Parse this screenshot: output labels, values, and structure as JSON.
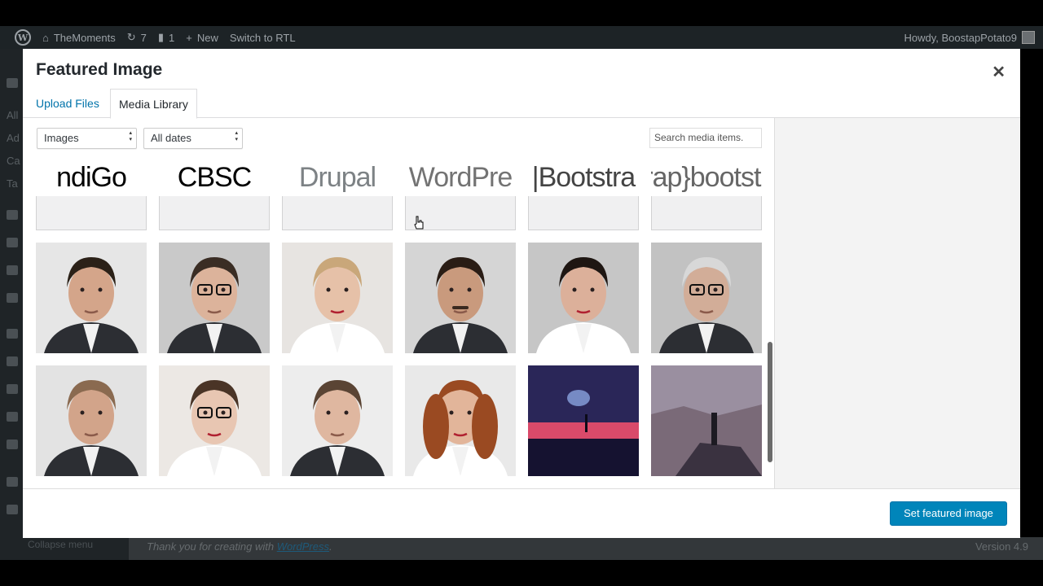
{
  "admin_bar": {
    "site_name": "TheMoments",
    "updates_count": "7",
    "comments_count": "1",
    "new_label": "New",
    "rtl_label": "Switch to RTL",
    "greeting": "Howdy, BoostapPotato9"
  },
  "admin_footer": {
    "thanks_prefix": "Thank you for creating with ",
    "thanks_link": "WordPress",
    "thanks_suffix": ".",
    "version": "Version 4.9",
    "collapse": "Collapse menu"
  },
  "sidebar_peek": [
    "All",
    "Ad",
    "Ca",
    "Ta"
  ],
  "modal": {
    "title": "Featured Image",
    "tabs": [
      {
        "label": "Upload Files",
        "active": false
      },
      {
        "label": "Media Library",
        "active": true
      }
    ],
    "filter_type": "Images",
    "filter_date": "All dates",
    "search_placeholder": "Search media items.",
    "set_button": "Set featured image"
  },
  "logos": [
    {
      "text": "ndiGo",
      "color": "#000000"
    },
    {
      "text": "CBSC",
      "color": "#000000"
    },
    {
      "text": "Drupal",
      "color": "#7d8285"
    },
    {
      "text": "WordPre",
      "color": "#737373"
    },
    {
      "text": "|Bootstra",
      "color": "#444444"
    },
    {
      "text": "rap}bootstr",
      "color": "#666666"
    }
  ],
  "photos": [
    {
      "kind": "man-suit",
      "bg": "#e6e6e6",
      "skin": "#d4a58a",
      "hair": "#2b2118"
    },
    {
      "kind": "man-glasses",
      "bg": "#c9c9c9",
      "skin": "#dcb39b",
      "hair": "#3a2d24"
    },
    {
      "kind": "woman-blonde",
      "bg": "#e7e4e1",
      "skin": "#e6c1a8",
      "hair": "#c9a77a"
    },
    {
      "kind": "man-mustache",
      "bg": "#d5d5d5",
      "skin": "#c99a7d",
      "hair": "#2a1d15"
    },
    {
      "kind": "woman-dark",
      "bg": "#c6c6c6",
      "skin": "#dcb09a",
      "hair": "#1e1612"
    },
    {
      "kind": "old-man",
      "bg": "#c2c2c2",
      "skin": "#d2ad98",
      "hair": "#d8d8d8"
    },
    {
      "kind": "man-beard",
      "bg": "#e3e3e3",
      "skin": "#d2a48a",
      "hair": "#8a6a50"
    },
    {
      "kind": "woman-glasses",
      "bg": "#ece8e4",
      "skin": "#e8c6b2",
      "hair": "#4a3426"
    },
    {
      "kind": "man-young",
      "bg": "#ededed",
      "skin": "#dfb7a0",
      "hair": "#5a4434"
    },
    {
      "kind": "woman-curly",
      "bg": "#e9e9e9",
      "skin": "#e2b59a",
      "hair": "#9a4a22"
    },
    {
      "kind": "sunset",
      "bg": "#2a2658",
      "skin": "#d94a6a",
      "hair": "#151230"
    },
    {
      "kind": "canyon",
      "bg": "#9a8fa0",
      "skin": "#7a6a78",
      "hair": "#3a3240"
    }
  ]
}
